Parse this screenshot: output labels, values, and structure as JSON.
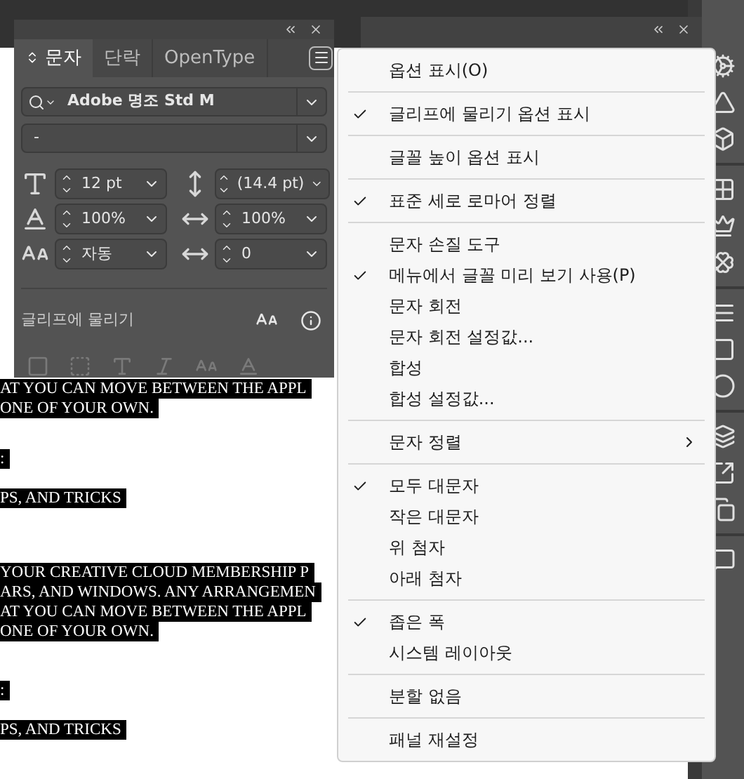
{
  "character_panel": {
    "tabs": [
      {
        "label": "문자",
        "selected": true
      },
      {
        "label": "단락",
        "selected": false
      },
      {
        "label": "OpenType",
        "selected": false
      }
    ],
    "font_family": "Adobe 명조 Std M",
    "font_style": "-",
    "fields": [
      {
        "value": "12 pt"
      },
      {
        "value": "(14.4 pt)"
      },
      {
        "value": "100%"
      },
      {
        "value": "100%"
      },
      {
        "value": "자동"
      },
      {
        "value": "0"
      }
    ],
    "snap_label": "글리프에 물리기"
  },
  "document_blocks": [
    [
      "AT YOU CAN MOVE BETWEEN THE APPL",
      "ONE OF YOUR OWN."
    ],
    [
      ":"
    ],
    [
      "PS, AND TRICKS"
    ],
    [
      "YOUR CREATIVE CLOUD MEMBERSHIP P",
      "ARS, AND WINDOWS. ANY ARRANGEMEN",
      "AT YOU CAN MOVE BETWEEN THE APPL",
      "ONE OF YOUR OWN."
    ],
    [
      ":"
    ],
    [
      "PS, AND TRICKS"
    ]
  ],
  "menu": [
    [
      {
        "label": "옵션 표시(O)",
        "checked": false,
        "submenu": false
      }
    ],
    [
      {
        "label": "글리프에 물리기 옵션 표시",
        "checked": true,
        "submenu": false
      }
    ],
    [
      {
        "label": "글꼴 높이 옵션 표시",
        "checked": false,
        "submenu": false
      }
    ],
    [
      {
        "label": "표준 세로 로마어 정렬",
        "checked": true,
        "submenu": false
      }
    ],
    [
      {
        "label": "문자 손질 도구",
        "checked": false,
        "submenu": false
      },
      {
        "label": "메뉴에서 글꼴 미리 보기 사용(P)",
        "checked": true,
        "submenu": false
      },
      {
        "label": "문자 회전",
        "checked": false,
        "submenu": false
      },
      {
        "label": "문자 회전 설정값...",
        "checked": false,
        "submenu": false
      },
      {
        "label": "합성",
        "checked": false,
        "submenu": false
      },
      {
        "label": "합성 설정값...",
        "checked": false,
        "submenu": false
      }
    ],
    [
      {
        "label": "문자 정렬",
        "checked": false,
        "submenu": true
      }
    ],
    [
      {
        "label": "모두 대문자",
        "checked": true,
        "submenu": false
      },
      {
        "label": "작은 대문자",
        "checked": false,
        "submenu": false
      },
      {
        "label": "위 첨자",
        "checked": false,
        "submenu": false
      },
      {
        "label": "아래 첨자",
        "checked": false,
        "submenu": false
      }
    ],
    [
      {
        "label": "좁은 폭",
        "checked": true,
        "submenu": false
      },
      {
        "label": "시스템 레이아웃",
        "checked": false,
        "submenu": false
      }
    ],
    [
      {
        "label": "분할 없음",
        "checked": false,
        "submenu": false
      }
    ],
    [
      {
        "label": "패널 재설정",
        "checked": false,
        "submenu": false
      }
    ]
  ]
}
